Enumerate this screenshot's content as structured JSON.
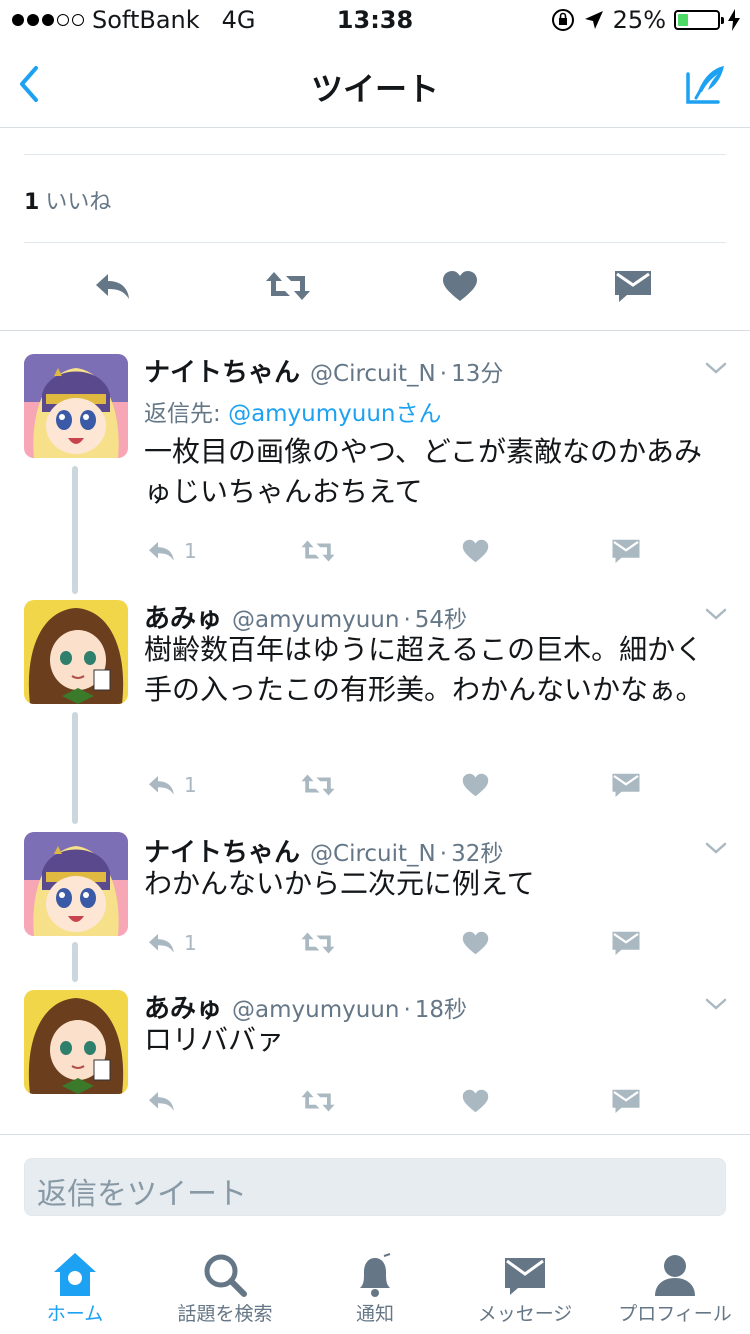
{
  "status_bar": {
    "carrier": "SoftBank",
    "network": "4G",
    "time": "13:38",
    "battery_percent": "25%",
    "battery_level": 0.25,
    "signal_bars_filled": 3,
    "signal_bars_total": 5
  },
  "nav": {
    "title": "ツイート",
    "back_icon": "chevron-left-icon",
    "compose_icon": "compose-icon",
    "accent_color": "#1da1f2"
  },
  "stats": {
    "likes_count": "1",
    "likes_label": "いいね"
  },
  "tweets": [
    {
      "name": "ナイトちゃん",
      "handle": "@Circuit_N",
      "time": "13分",
      "reply_to_label": "返信先: ",
      "reply_to_mention": "@amyumyuunさん",
      "text": "一枚目の画像のやつ、どこが素敵なのかあみゅじいちゃんおちえて",
      "reply_count": "1"
    },
    {
      "name": "あみゅ",
      "handle": "@amyumyuun",
      "time": "54秒",
      "text": "樹齢数百年はゆうに超えるこの巨木。細かく手の入ったこの有形美。わかんないかなぁ。",
      "reply_count": "1"
    },
    {
      "name": "ナイトちゃん",
      "handle": "@Circuit_N",
      "time": "32秒",
      "text": "わかんないから二次元に例えて",
      "reply_count": "1"
    },
    {
      "name": "あみゅ",
      "handle": "@amyumyuun",
      "time": "18秒",
      "text": "ロリババァ",
      "reply_count": ""
    }
  ],
  "reply_box": {
    "placeholder": "返信をツイート"
  },
  "tab_bar": {
    "tabs": [
      {
        "label": "ホーム",
        "icon": "home-icon",
        "active": true
      },
      {
        "label": "話題を検索",
        "icon": "search-icon",
        "active": false
      },
      {
        "label": "通知",
        "icon": "bell-icon",
        "active": false
      },
      {
        "label": "メッセージ",
        "icon": "envelope-icon",
        "active": false
      },
      {
        "label": "プロフィール",
        "icon": "profile-icon",
        "active": false
      }
    ]
  }
}
